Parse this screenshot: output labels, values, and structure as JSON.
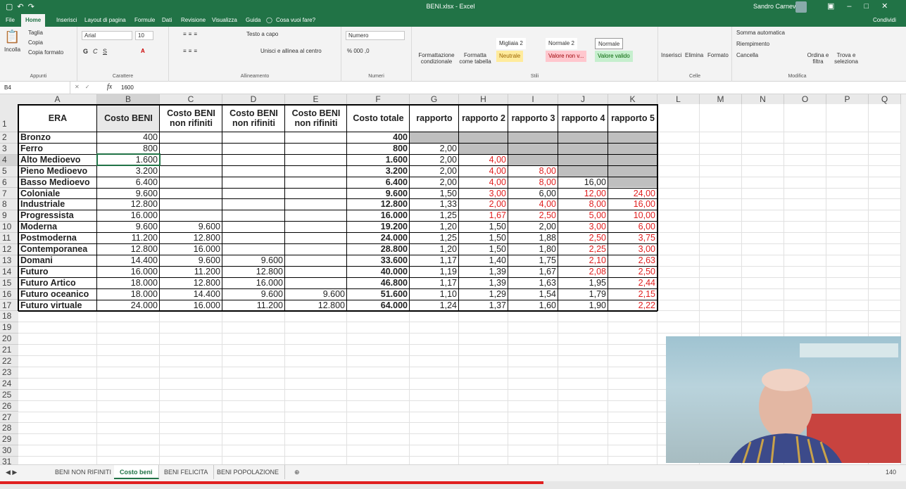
{
  "title_bar": {
    "document": "BENI.xlsx - Excel",
    "user": "Sandro Carnevali"
  },
  "menu_tabs": [
    "File",
    "Home",
    "Inserisci",
    "Layout di pagina",
    "Formule",
    "Dati",
    "Revisione",
    "Visualizza",
    "Guida",
    "Cosa vuoi fare?"
  ],
  "share_label": "Condividi",
  "ribbon": {
    "appunti": {
      "incolla": "Incolla",
      "taglia": "Taglia",
      "copia": "Copia",
      "copia_formato": "Copia formato",
      "label": "Appunti"
    },
    "carattere": {
      "font": "Arial",
      "size": "10",
      "label": "Carattere"
    },
    "allineamento": {
      "testo_a_capo": "Testo a capo",
      "unisci": "Unisci e allinea al centro",
      "label": "Allineamento"
    },
    "numeri": {
      "format": "Numero",
      "label": "Numeri"
    },
    "stili": {
      "formattazione": "Formattazione condizionale",
      "formatta_tabella": "Formatta come tabella",
      "migliaia": "Migliaia 2",
      "normale2": "Normale 2",
      "normale": "Normale",
      "neutrale": "Neutrale",
      "valore_non": "Valore non v...",
      "valore_valido": "Valore valido",
      "label": "Stili"
    },
    "celle": {
      "inserisci": "Inserisci",
      "elimina": "Elimina",
      "formato": "Formato",
      "label": "Celle"
    },
    "modifica": {
      "somma": "Somma automatica",
      "riempimento": "Riempimento",
      "cancella": "Cancella",
      "ordina": "Ordina e filtra",
      "trova": "Trova e seleziona",
      "label": "Modifica"
    }
  },
  "formula_bar": {
    "name_box": "B4",
    "fx": "fx",
    "value": "1600"
  },
  "columns": [
    "A",
    "B",
    "C",
    "D",
    "E",
    "F",
    "G",
    "H",
    "I",
    "J",
    "K",
    "L",
    "M",
    "N",
    "O",
    "P",
    "Q"
  ],
  "headers": [
    "ERA",
    "Costo BENI",
    "Costo BENI non rifiniti",
    "Costo BENI non rifiniti",
    "Costo BENI non rifiniti",
    "Costo totale",
    "rapporto",
    "rapporto 2",
    "rapporto 3",
    "rapporto 4",
    "rapporto 5"
  ],
  "rows": [
    [
      "Bronzo",
      "400",
      "",
      "",
      "",
      "400",
      "",
      "",
      "",
      "",
      ""
    ],
    [
      "Ferro",
      "800",
      "",
      "",
      "",
      "800",
      "2,00",
      "",
      "",
      "",
      ""
    ],
    [
      "Alto Medioevo",
      "1.600",
      "",
      "",
      "",
      "1.600",
      "2,00",
      "4,00",
      "",
      "",
      ""
    ],
    [
      "Pieno Medioevo",
      "3.200",
      "",
      "",
      "",
      "3.200",
      "2,00",
      "4,00",
      "8,00",
      "",
      ""
    ],
    [
      "Basso Medioevo",
      "6.400",
      "",
      "",
      "",
      "6.400",
      "2,00",
      "4,00",
      "8,00",
      "16,00",
      ""
    ],
    [
      "Coloniale",
      "9.600",
      "",
      "",
      "",
      "9.600",
      "1,50",
      "3,00",
      "6,00",
      "12,00",
      "24,00"
    ],
    [
      "Industriale",
      "12.800",
      "",
      "",
      "",
      "12.800",
      "1,33",
      "2,00",
      "4,00",
      "8,00",
      "16,00"
    ],
    [
      "Progressista",
      "16.000",
      "",
      "",
      "",
      "16.000",
      "1,25",
      "1,67",
      "2,50",
      "5,00",
      "10,00"
    ],
    [
      "Moderna",
      "9.600",
      "9.600",
      "",
      "",
      "19.200",
      "1,20",
      "1,50",
      "2,00",
      "3,00",
      "6,00"
    ],
    [
      "Postmoderna",
      "11.200",
      "12.800",
      "",
      "",
      "24.000",
      "1,25",
      "1,50",
      "1,88",
      "2,50",
      "3,75"
    ],
    [
      "Contemporanea",
      "12.800",
      "16.000",
      "",
      "",
      "28.800",
      "1,20",
      "1,50",
      "1,80",
      "2,25",
      "3,00"
    ],
    [
      "Domani",
      "14.400",
      "9.600",
      "9.600",
      "",
      "33.600",
      "1,17",
      "1,40",
      "1,75",
      "2,10",
      "2,63"
    ],
    [
      "Futuro",
      "16.000",
      "11.200",
      "12.800",
      "",
      "40.000",
      "1,19",
      "1,39",
      "1,67",
      "2,08",
      "2,50"
    ],
    [
      "Futuro Artico",
      "18.000",
      "12.800",
      "16.000",
      "",
      "46.800",
      "1,17",
      "1,39",
      "1,63",
      "1,95",
      "2,44"
    ],
    [
      "Futuro oceanico",
      "18.000",
      "14.400",
      "9.600",
      "9.600",
      "51.600",
      "1,10",
      "1,29",
      "1,54",
      "1,79",
      "2,15"
    ],
    [
      "Futuro virtuale",
      "24.000",
      "16.000",
      "11.200",
      "12.800",
      "64.000",
      "1,24",
      "1,37",
      "1,60",
      "1,90",
      "2,22"
    ]
  ],
  "red_cells": [
    [
      2,
      7
    ],
    [
      3,
      7
    ],
    [
      4,
      7
    ],
    [
      5,
      7
    ],
    [
      6,
      8
    ],
    [
      5,
      9
    ],
    [
      6,
      9
    ],
    [
      7,
      9
    ],
    [
      5,
      10
    ],
    [
      6,
      10
    ],
    [
      7,
      10
    ],
    [
      8,
      10
    ],
    [
      9,
      10
    ],
    [
      10,
      10
    ],
    [
      11,
      10
    ],
    [
      12,
      10
    ],
    [
      13,
      10
    ],
    [
      14,
      10
    ],
    [
      15,
      10
    ],
    [
      6,
      7
    ],
    [
      7,
      8
    ],
    [
      7,
      7
    ],
    [
      8,
      9
    ],
    [
      9,
      9
    ],
    [
      10,
      9
    ],
    [
      11,
      9
    ],
    [
      12,
      9
    ],
    [
      4,
      8
    ],
    [
      3,
      8
    ]
  ],
  "sheet_tabs": [
    "BENI NON RIFINITI",
    "Costo beni",
    "BENI FELICITA",
    "BENI POPOLAZIONE"
  ],
  "active_sheet": "Costo beni",
  "zoom": "140",
  "video_progress": 0.6
}
